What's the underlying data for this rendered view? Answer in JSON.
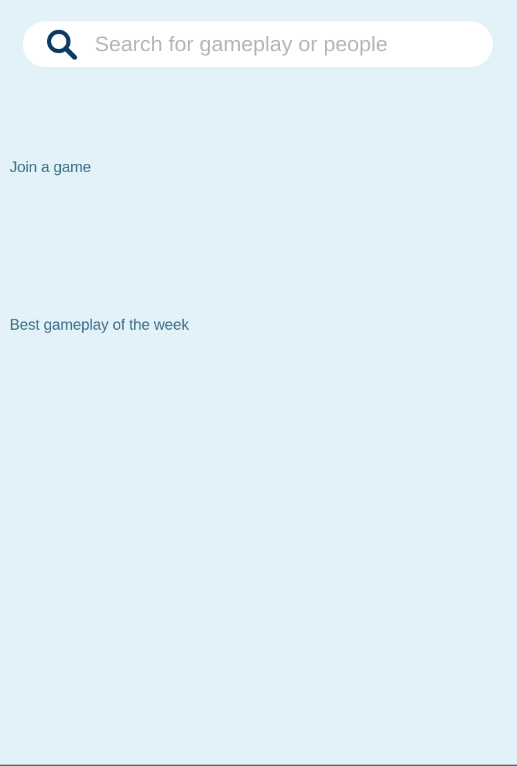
{
  "search": {
    "placeholder": "Search for gameplay or people",
    "value": "",
    "icon": "search-icon"
  },
  "sections": {
    "join": {
      "title": "Join a game"
    },
    "best": {
      "title": "Best gameplay of the week"
    }
  },
  "colors": {
    "background": "#e3f2f8",
    "search_bar": "#ffffff",
    "search_icon": "#0d3a63",
    "placeholder_text": "#b5b5b5",
    "section_title": "#3b6f87"
  }
}
